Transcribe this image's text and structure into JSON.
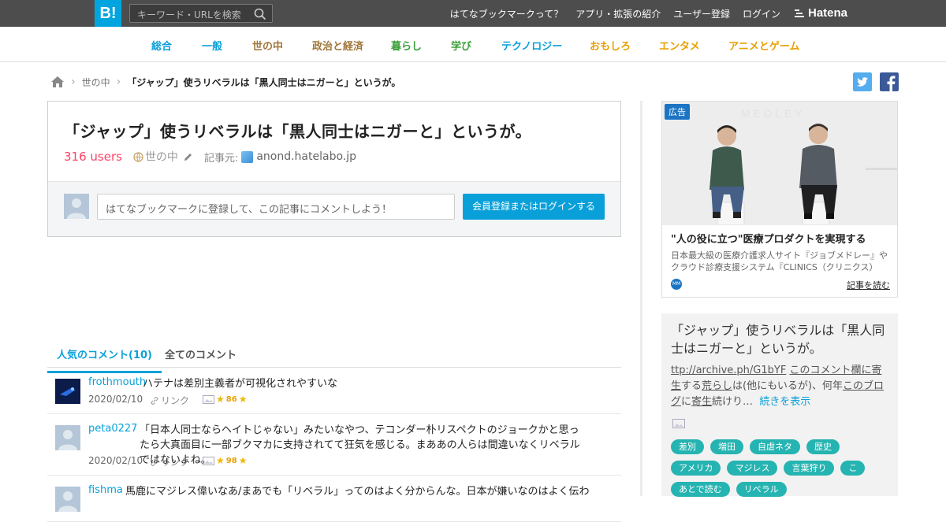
{
  "header": {
    "logo": "B!",
    "search_placeholder": "キーワード・URLを検索",
    "links": [
      "はてなブックマークって？",
      "アプリ・拡張の紹介",
      "ユーザー登録",
      "ログイン"
    ],
    "brand": "Hatena"
  },
  "categories": [
    {
      "label": "総合",
      "color": "#09a0d9"
    },
    {
      "label": "一般",
      "color": "#09a0d9"
    },
    {
      "label": "世の中",
      "color": "#a0763a"
    },
    {
      "label": "政治と経済",
      "color": "#a0763a"
    },
    {
      "label": "暮らし",
      "color": "#3ba03a"
    },
    {
      "label": "学び",
      "color": "#3ba03a"
    },
    {
      "label": "テクノロジー",
      "color": "#09a0d9"
    },
    {
      "label": "おもしろ",
      "color": "#e8a000"
    },
    {
      "label": "エンタメ",
      "color": "#e8a000"
    },
    {
      "label": "アニメとゲーム",
      "color": "#e8a000"
    }
  ],
  "breadcrumb": {
    "category": "世の中",
    "title": "「ジャップ」使うリベラルは「黒人同士はニガーと」というが。"
  },
  "entry": {
    "title": "「ジャップ」使うリベラルは「黒人同士はニガーと」というが。",
    "users": "316 users",
    "category": "世の中",
    "source_label": "記事元:",
    "source_url": "anond.hatelabo.jp",
    "comment_placeholder": "はてなブックマークに登録して、この記事にコメントしよう！",
    "login_button": "会員登録またはログインする"
  },
  "tabs": {
    "popular": "人気のコメント(10)",
    "all": "全てのコメント"
  },
  "comments": [
    {
      "user": "frothmouth",
      "text": "ハテナは差別主義者が可視化されやすいな",
      "date": "2020/02/10",
      "link": "リンク",
      "stars": "86"
    },
    {
      "user": "peta0227",
      "text": "「日本人同士ならヘイトじゃない」みたいなやつ、テコンダー朴リスペクトのジョークかと思ったら大真面目に一部ブクマカに支持されてて狂気を感じる。まああの人らは間違いなくリベラルではないよね。",
      "date": "2020/02/10",
      "link": "リンク",
      "stars": "98"
    },
    {
      "user": "fishma",
      "text": "馬鹿にマジレス偉いなあ/まあでも「リベラル」ってのはよく分からんな。日本が嫌いなのはよく伝わ",
      "date": "",
      "link": "",
      "stars": ""
    }
  ],
  "ad": {
    "badge": "広告",
    "headline": "\"人の役に立つ\"医療プロダクトを実現する",
    "body": "日本最大級の医療介護求人サイト『ジョブメドレー』やクラウド診療支援システム『CLINICS（クリニクス）",
    "more": "記事を読む"
  },
  "side": {
    "title": "「ジャップ」使うリベラルは「黒人同士はニガーと」というが。",
    "comment_parts": [
      "ttp://archive.ph/G1bYF",
      " ",
      "このコメント欄に寄生",
      "する",
      "荒らし",
      "は(他にもいるが)、何年",
      "この",
      "ブログ",
      "に",
      "寄生",
      "続けり…"
    ],
    "more": "続きを表示",
    "tags": [
      "差別",
      "増田",
      "自虐ネタ",
      "歴史",
      "アメリカ",
      "マジレス",
      "言葉狩り",
      "こ",
      "あとで読む",
      "リベラル"
    ]
  }
}
